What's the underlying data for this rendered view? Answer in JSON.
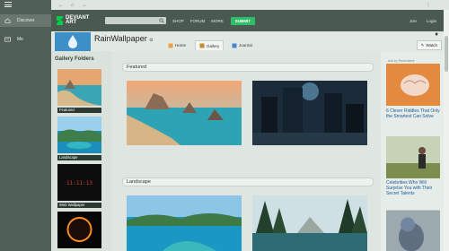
{
  "app_sidebar": {
    "items": [
      {
        "label": "Discover",
        "icon": "home-icon"
      },
      {
        "label": "Me",
        "icon": "card-icon"
      }
    ]
  },
  "browser": {
    "back": "←",
    "refresh": "⌂",
    "forward": "→",
    "more": "⋮"
  },
  "header": {
    "logo_line1": "DEVIANT",
    "logo_line2": "ART",
    "search_placeholder": "",
    "nav": [
      "SHOP",
      "FORUM",
      "MORE"
    ],
    "submit_label": "SUBMIT",
    "right_links": [
      "Join",
      "Login"
    ],
    "accent": "#2fbf68"
  },
  "profile": {
    "username": "RainWallpaper",
    "badge": "⊙",
    "tabs": [
      {
        "label": "Home",
        "icon": "home-icon",
        "selected": false
      },
      {
        "label": "Gallery",
        "icon": "gallery-icon",
        "selected": true
      },
      {
        "label": "Journal",
        "icon": "journal-icon",
        "selected": false
      }
    ],
    "watch_label": "Watch"
  },
  "folders": {
    "title": "Gallery Folders",
    "items": [
      {
        "label": "Featured"
      },
      {
        "label": "Landscape"
      },
      {
        "label": "Web Wallpaper"
      },
      {
        "label": ""
      }
    ]
  },
  "gallery": {
    "sections": [
      {
        "title": "Featured"
      },
      {
        "title": "Landscape"
      }
    ]
  },
  "ads": {
    "tag": "Ads by Revcontent",
    "items": [
      {
        "text": "6 Clever Riddles That Only the Smartest Can Solve"
      },
      {
        "text": "Celebrities Who Will Surprise You with Their Secret Talents"
      },
      {
        "text": ""
      }
    ]
  }
}
